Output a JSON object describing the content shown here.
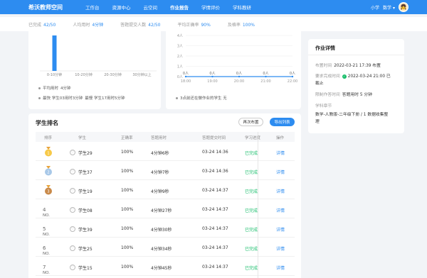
{
  "topbar": {
    "logo": "希沃教师空间",
    "nav": [
      "工作台",
      "资源中心",
      "云空间",
      "作业报告",
      "学情评价",
      "学科教研"
    ],
    "grade": "小学",
    "subject": "数学",
    "chevron": "▾",
    "avatar_icon": "👧"
  },
  "stats": [
    {
      "label": "已完成",
      "value": "42/50"
    },
    {
      "label": "人均用时",
      "value": "4分钟"
    },
    {
      "label": "答题提交人数",
      "value": "42/50"
    },
    {
      "label": "平均正确率",
      "value": "90%"
    },
    {
      "label": "及格率",
      "value": "100%"
    }
  ],
  "left_chart": {
    "legend": [
      {
        "label": "平均用时",
        "value": "4分钟"
      },
      {
        "label": "最快 学生03用时3分钟",
        "extra": "最慢 学生17用时5分钟"
      }
    ]
  },
  "right_chart": {
    "note": "3点前还在做作业的学生 无"
  },
  "chart_data": [
    {
      "type": "bar",
      "categories": [
        "0-10分钟",
        "10-20分钟",
        "20-30分钟",
        "30分钟以上"
      ],
      "values": [
        42,
        0,
        0,
        0
      ],
      "category_labels_prefix": [
        "",
        "",
        "",
        ""
      ]
    },
    {
      "type": "line",
      "x": [
        "18:00",
        "19:00",
        "20:00",
        "21:00",
        "22:00"
      ],
      "yticks": [
        "4人",
        "3人",
        "2人",
        "1人",
        "0人"
      ],
      "y": [
        0,
        0,
        0,
        0,
        0
      ],
      "point_labels": [
        "0人",
        "0人",
        "0人",
        "0人",
        "0人"
      ],
      "ylim": [
        0,
        4
      ]
    }
  ],
  "ranking": {
    "title": "学生排名",
    "btn_remind": "再次布置",
    "btn_export": "导出列表",
    "headers": [
      "排序",
      "学生",
      "正确率",
      "答题用时",
      "答题提交时间",
      "学习进度",
      "操作"
    ],
    "rows": [
      {
        "rank": "1",
        "student": "学生29",
        "accuracy": "100%",
        "time": "4分钟6秒",
        "submitted": "03-24 14:36",
        "progress": "已完成",
        "action": "详情"
      },
      {
        "rank": "2",
        "student": "学生37",
        "accuracy": "100%",
        "time": "4分钟7秒",
        "submitted": "03-24 14:36",
        "progress": "已完成",
        "action": "详情"
      },
      {
        "rank": "3",
        "student": "学生19",
        "accuracy": "100%",
        "time": "4分钟9秒",
        "submitted": "03-24 14:37",
        "progress": "已完成",
        "action": "详情"
      },
      {
        "rank": "4",
        "student": "学生08",
        "accuracy": "100%",
        "time": "4分钟27秒",
        "submitted": "03-24 14:37",
        "progress": "已完成",
        "action": "详情"
      },
      {
        "rank": "5",
        "student": "学生39",
        "accuracy": "100%",
        "time": "4分钟30秒",
        "submitted": "03-24 14:37",
        "progress": "已完成",
        "action": "详情"
      },
      {
        "rank": "6",
        "student": "学生25",
        "accuracy": "100%",
        "time": "4分钟34秒",
        "submitted": "03-24 14:37",
        "progress": "已完成",
        "action": "详情"
      },
      {
        "rank": "7",
        "student": "学生15",
        "accuracy": "100%",
        "time": "4分钟45秒",
        "submitted": "03-24 14:37",
        "progress": "已完成",
        "action": "详情"
      }
    ],
    "rank_prefix": "NO."
  },
  "details": {
    "title": "作业详情",
    "assign_label": "布置时间",
    "assign_value": "2022-03-21 17:39 布置",
    "deadline_label": "要求完成时间",
    "deadline_value": "2022-03-24 21:00 已",
    "deadline_value2": "截止",
    "limit_label": "限制作答时间",
    "limit_value": "答题用时 5 分钟",
    "chapter_label": "学科章节",
    "chapter_value": "数学-人教版-二年级下册 / 1 数据收集整",
    "chapter_value2": "理"
  },
  "colors": {
    "primary": "#2d8cf0",
    "success": "#19be6b",
    "gold": "#f7c948",
    "silver": "#a8c8e8",
    "bronze": "#c98a4a"
  }
}
